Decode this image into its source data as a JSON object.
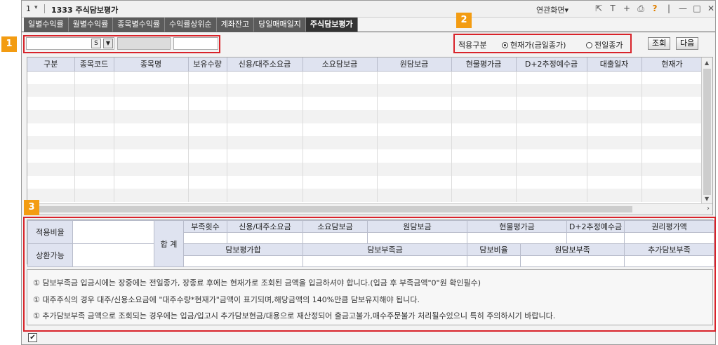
{
  "titlebar": {
    "screen_num": "1",
    "screen_code": "1333",
    "title": "주식담보평가",
    "related_label": "연관화면",
    "help_glyph": "?"
  },
  "tabs": [
    {
      "label": "일별수익률",
      "active": false
    },
    {
      "label": "월별수익률",
      "active": false
    },
    {
      "label": "종목별수익률",
      "active": false
    },
    {
      "label": "수익률상위순",
      "active": false
    },
    {
      "label": "계좌잔고",
      "active": false
    },
    {
      "label": "당일매매일지",
      "active": false
    },
    {
      "label": "주식담보평가",
      "active": true
    }
  ],
  "condition": {
    "account_s_label": "S",
    "apply_label": "적용구분",
    "radio_current": "현재가(금일종가)",
    "radio_prev": "전일종가",
    "selected": "current",
    "query_button": "조회",
    "next_button": "다음"
  },
  "grid": {
    "columns": [
      "구분",
      "종목코드",
      "종목명",
      "보유수량",
      "신용/대주소요금",
      "소요담보금",
      "원담보금",
      "현물평가금",
      "D+2추정예수금",
      "대출일자",
      "현재가"
    ],
    "row_count": 10
  },
  "summary": {
    "apply_rate_label": "적용비율",
    "repay_label": "상환가능",
    "total_label": "합 계",
    "row1_headers": [
      "부족횟수",
      "신용/대주소요금",
      "소요담보금",
      "원담보금",
      "현물평가금",
      "D+2추정예수금",
      "권리평가액"
    ],
    "row2_headers": [
      "담보평가합",
      "담보부족금",
      "담보비율",
      "원담보부족",
      "추가담보부족"
    ]
  },
  "notices": [
    "① 담보부족금 입금시에는 장중에는 전일종가, 장종료 후에는 현재가로 조회된 금액을 입금하셔야 합니다.(입금 후 부족금액\"0\"원 확인필수)",
    "① 대주주식의 경우 대주/신용소요금에 \"대주수량*현재가\"금액이 표기되며,해당금액의 140%만큼 담보유지해야 됩니다.",
    "① 추가담보부족 금액으로 조회되는 경우에는 입금/입고시 추가담보현금/대용으로 재산정되어 출금고불가,매수주문불가 처리될수있으니 특히 주의하시기 바랍니다."
  ],
  "callouts": [
    "1",
    "2",
    "3"
  ],
  "colors": {
    "tab_bg": "#5b5b5b",
    "tab_active_bg": "#333333",
    "header_bg": "#dfe3f0",
    "callout_orange": "#f39c12",
    "highlight_red": "#d8232a"
  }
}
